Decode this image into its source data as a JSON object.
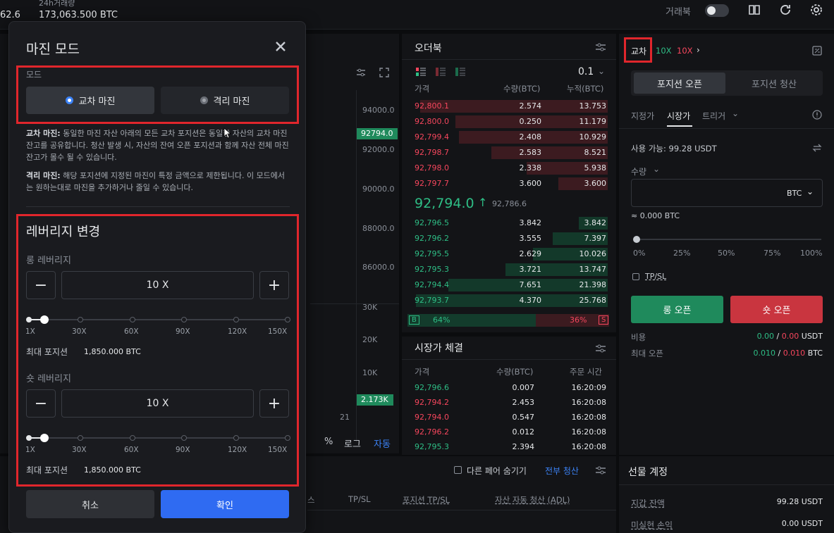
{
  "header": {
    "price_fragment": "62.6",
    "volume_label": "24h거래량",
    "volume_value": "173,063.500 BTC",
    "tradebook_label": "거래북"
  },
  "chart_panel": {
    "price_ticks": [
      "94000.0",
      "92000.0",
      "90000.0",
      "88000.0",
      "86000.0"
    ],
    "current_price_tag": "92794.0",
    "volume_ticks": [
      "30K",
      "20K",
      "10K"
    ],
    "volume_tag": "2.173K",
    "date_tick": "21",
    "scale_options": [
      "%",
      "로그",
      "자동"
    ]
  },
  "orderbook": {
    "title": "오더북",
    "precision": "0.1",
    "columns": [
      "가격",
      "수량(BTC)",
      "누적(BTC)"
    ],
    "asks": [
      {
        "price": "92,800.1",
        "qty": "2.574",
        "total": "13.753"
      },
      {
        "price": "92,800.0",
        "qty": "0.250",
        "total": "11.179"
      },
      {
        "price": "92,799.4",
        "qty": "2.408",
        "total": "10.929"
      },
      {
        "price": "92,798.7",
        "qty": "2.583",
        "total": "8.521"
      },
      {
        "price": "92,798.0",
        "qty": "2.338",
        "total": "5.938"
      },
      {
        "price": "92,797.7",
        "qty": "3.600",
        "total": "3.600"
      }
    ],
    "last_price": "92,794.0",
    "mark_price": "92,786.6",
    "bids": [
      {
        "price": "92,796.5",
        "qty": "3.842",
        "total": "3.842"
      },
      {
        "price": "92,796.2",
        "qty": "3.555",
        "total": "7.397"
      },
      {
        "price": "92,795.5",
        "qty": "2.629",
        "total": "10.026"
      },
      {
        "price": "92,795.3",
        "qty": "3.721",
        "total": "13.747"
      },
      {
        "price": "92,794.4",
        "qty": "7.651",
        "total": "21.398"
      },
      {
        "price": "92,793.7",
        "qty": "4.370",
        "total": "25.768"
      }
    ],
    "buy_label": "B",
    "buy_pct": "64%",
    "sell_pct": "36%",
    "sell_label": "S"
  },
  "trades": {
    "title": "시장가 체결",
    "columns": [
      "가격",
      "수량(BTC)",
      "주문 시간"
    ],
    "rows": [
      {
        "price": "92,796.6",
        "qty": "0.007",
        "time": "16:20:09",
        "side": "buy"
      },
      {
        "price": "92,794.2",
        "qty": "2.453",
        "time": "16:20:08",
        "side": "sell"
      },
      {
        "price": "92,794.0",
        "qty": "0.547",
        "time": "16:20:08",
        "side": "sell"
      },
      {
        "price": "92,796.2",
        "qty": "0.012",
        "time": "16:20:08",
        "side": "sell"
      },
      {
        "price": "92,795.3",
        "qty": "2.394",
        "time": "16:20:08",
        "side": "buy"
      }
    ]
  },
  "trade_panel": {
    "margin_mode": "교차",
    "long_lev": "10X",
    "short_lev": "10X",
    "tab_open": "포지션 오픈",
    "tab_close": "포지션 청산",
    "order_types": [
      "지정가",
      "시장가",
      "트리거"
    ],
    "available": "사용 가능: 99.28 USDT",
    "qty_label": "수량",
    "unit": "BTC",
    "approx": "≈ 0.000 BTC",
    "pct_ticks": [
      "0%",
      "25%",
      "50%",
      "75%",
      "100%"
    ],
    "tpsl": "TP/SL",
    "long_btn": "롱 오픈",
    "short_btn": "숏 오픈",
    "fee_label": "비용",
    "fee_long": "0.00",
    "fee_short": "0.00",
    "fee_unit": "USDT",
    "max_label": "최대 오픈",
    "max_long": "0.010",
    "max_short": "0.010",
    "max_unit": "BTC"
  },
  "bottom_panel": {
    "hide_pairs": "다른 페어 숨기기",
    "close_all": "전부 청산",
    "columns": [
      "스",
      "TP/SL",
      "포지션 TP/SL",
      "자산 자동 청산 (ADL)"
    ]
  },
  "futures_account": {
    "title": "선물 계정",
    "wallet_label": "지갑 잔액",
    "wallet_value": "99.28 USDT",
    "unrealized_label": "미실현 손익",
    "unrealized_value": "0.00 USDT"
  },
  "modal": {
    "title": "마진 모드",
    "mode_label": "모드",
    "cross_btn": "교차 마진",
    "isolated_btn": "격리 마진",
    "cross_desc_bold": "교차 마진:",
    "cross_desc": " 동일한 마진 자산 아래의 모든 교차 포지션은 동일한 자산의 교차 마진 잔고를 공유합니다. 청산 발생 시, 자산의 잔여 오픈 포지션과 함께 자산 전체 마진 잔고가 몰수 될 수 있습니다.",
    "isolated_desc_bold": "격리 마진:",
    "isolated_desc": " 해당 포지션에 지정된 마진이 특정 금액으로 제한됩니다. 이 모드에서는 원하는대로 마진을 추가하거나 줄일 수 있습니다.",
    "leverage_title": "레버리지 변경",
    "long_label": "롱 레버리지",
    "long_value": "10 X",
    "long_level": 10,
    "short_label": "숏 레버리지",
    "short_value": "10 X",
    "short_level": 10,
    "lev_ticks": [
      "1X",
      "30X",
      "60X",
      "90X",
      "120X",
      "150X"
    ],
    "max_pos_label": "최대 포지션",
    "long_max_pos": "1,850.000 BTC",
    "short_max_pos": "1,850.000 BTC",
    "cancel_btn": "취소",
    "confirm_btn": "확인"
  }
}
